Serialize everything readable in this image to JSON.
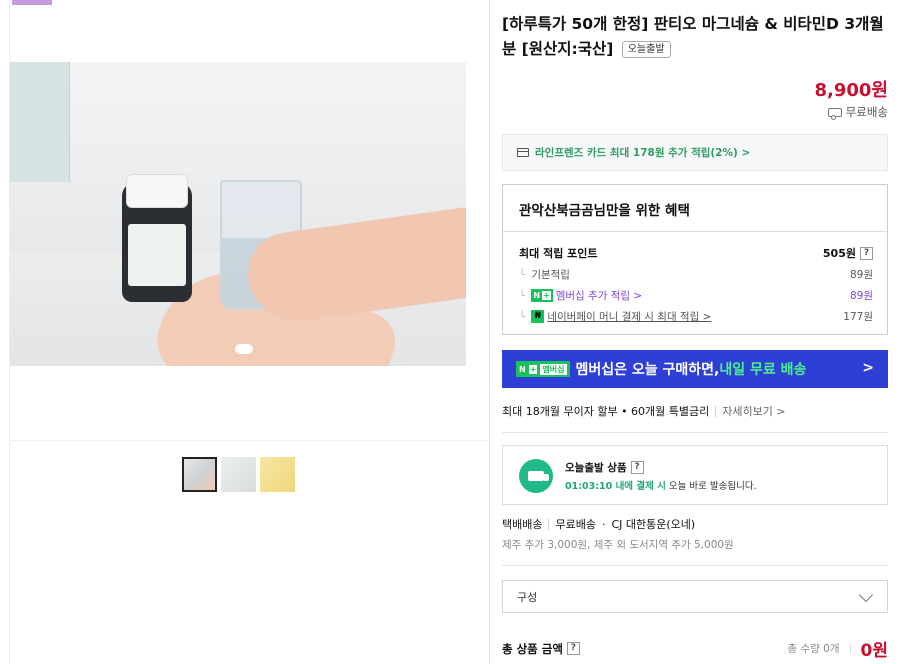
{
  "product": {
    "title": "[하루특가 50개 한정] 판티오 마그네슘 & 비타민D 3개월분 [원산지:국산]",
    "badge": "오늘출발",
    "price": "8,900원",
    "shipping": "무료배송"
  },
  "card_offer": "라인프렌즈 카드 최대 178원 추가 적립(2%) >",
  "benefit": {
    "title": "관악산북금곰님만을 위한 혜택",
    "max_points_label": "최대 적립 포인트",
    "max_points_value": "505원",
    "rows": [
      {
        "label": "기본적립",
        "value": "89원"
      },
      {
        "label": "멤버십 추가 적립 >",
        "value": "89원"
      },
      {
        "label": "네이버페이 머니 결제 시 최대 적립 >",
        "value": "177원"
      }
    ]
  },
  "membership": {
    "badge_n": "N",
    "badge_plus": "+",
    "badge_text": "멤버십",
    "text": "멤버십은 오늘 구매하면, ",
    "highlight": "내일 무료 배송",
    "arrow": ">"
  },
  "installment": {
    "text": "최대 18개월 무이자 할부 • 60개월 특별금리",
    "link": "자세히보기 >"
  },
  "delivery": {
    "title": "오늘출발 상품",
    "countdown": "01:03:10 내에 결제 시",
    "desc": "오늘 바로 발송됩니다."
  },
  "shipping_info": {
    "type": "택배배송",
    "fee": "무료배송",
    "carrier": "CJ 대한통운(오네)",
    "extra": "제주 추가 3,000원, 제주 외 도서지역 추가 5,000원"
  },
  "option_select": {
    "placeholder": "구성"
  },
  "total": {
    "label": "총 상품 금액",
    "qty": "총 수량 0개",
    "amount": "0원"
  },
  "help_mark": "?",
  "colors": {
    "price_red": "#c8102e",
    "naver_green": "#18c25a",
    "membership_blue": "#2d3fd4"
  }
}
